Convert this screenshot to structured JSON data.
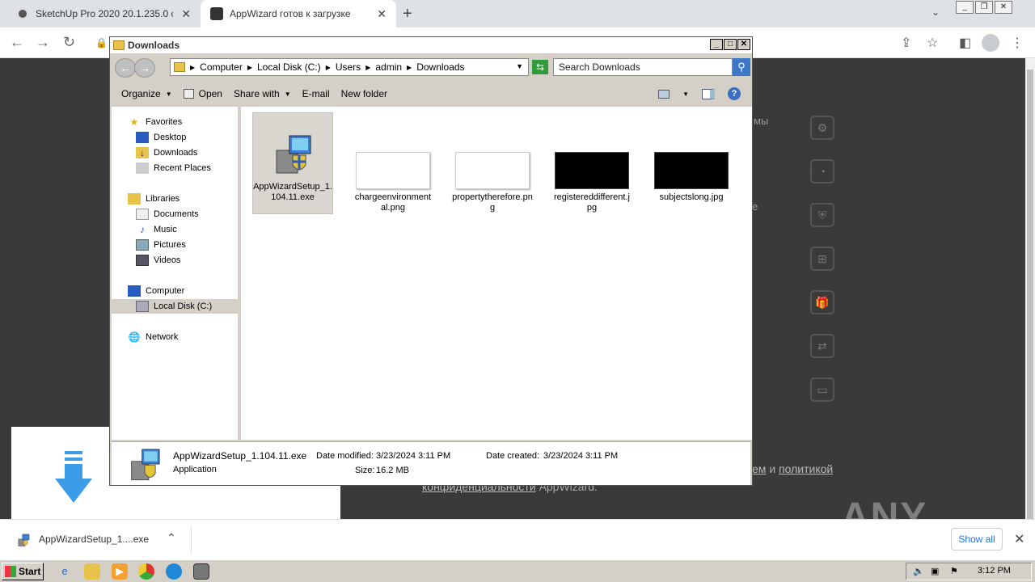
{
  "browser": {
    "tabs": [
      {
        "title": "SketchUp Pro 2020 20.1.235.0 скачать",
        "active": false
      },
      {
        "title": "AppWizard готов к загрузке",
        "active": true
      }
    ],
    "new_tab": "+",
    "tab_menu": "⌄"
  },
  "page": {
    "fragment_1": "мы",
    "fragment_2": "е",
    "legal_part1": "ем",
    "legal_and": "и",
    "legal_link2": "политикой",
    "legal_line2_link": "конфиденциальности",
    "legal_line2_rest": "AppWizard.",
    "watermark": "ANY RUN"
  },
  "explorer": {
    "title": "Downloads",
    "breadcrumb": [
      "Computer",
      "Local Disk (C:)",
      "Users",
      "admin",
      "Downloads"
    ],
    "search_placeholder": "Search Downloads",
    "commands": {
      "organize": "Organize",
      "open": "Open",
      "share_with": "Share with",
      "email": "E-mail",
      "new_folder": "New folder"
    },
    "nav": {
      "favorites": "Favorites",
      "desktop": "Desktop",
      "downloads": "Downloads",
      "recent_places": "Recent Places",
      "libraries": "Libraries",
      "documents": "Documents",
      "music": "Music",
      "pictures": "Pictures",
      "videos": "Videos",
      "computer": "Computer",
      "local_disk": "Local Disk (C:)",
      "network": "Network"
    },
    "files": [
      {
        "name": "AppWizardSetup_1.104.11.exe",
        "kind": "exe"
      },
      {
        "name": "chargeenvironmental.png",
        "kind": "white"
      },
      {
        "name": "propertytherefore.png",
        "kind": "white"
      },
      {
        "name": "registereddifferent.jpg",
        "kind": "black"
      },
      {
        "name": "subjectslong.jpg",
        "kind": "black"
      }
    ],
    "details": {
      "filename": "AppWizardSetup_1.104.11.exe",
      "type": "Application",
      "modified_label": "Date modified:",
      "modified_value": "3/23/2024 3:11 PM",
      "created_label": "Date created:",
      "created_value": "3/23/2024 3:11 PM",
      "size_label": "Size:",
      "size_value": "16.2 MB"
    }
  },
  "download_shelf": {
    "filename": "AppWizardSetup_1....exe",
    "show_all": "Show all"
  },
  "taskbar": {
    "start": "Start",
    "clock": "3:12 PM"
  },
  "colors": {
    "page_bg": "#3a3a3a",
    "accent_blue": "#1a73e8",
    "win_face": "#d4d0c8",
    "download_arrow": "#3c9ce8"
  }
}
